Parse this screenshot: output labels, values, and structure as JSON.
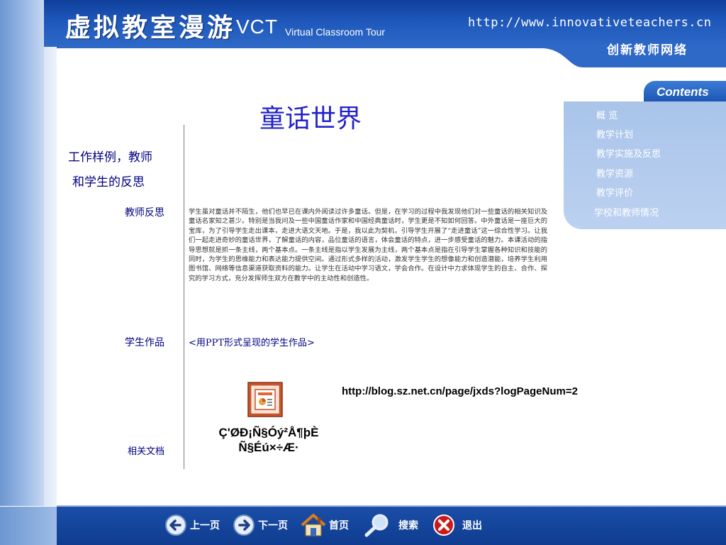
{
  "header": {
    "logo": "虚拟教室漫游",
    "vct": "VCT",
    "vct_subtitle": "Virtual Classroom Tour",
    "url": "http://www.innovativeteachers.cn",
    "org": "创新教师网络"
  },
  "contents": {
    "tab": "Contents",
    "items": [
      "概  览",
      "教学计划",
      "教学实施及反思",
      "教学资源",
      "教学评价",
      "学校和教师情况"
    ]
  },
  "main": {
    "title": "童话世界",
    "side_heading_1": "工作样例，教师",
    "side_heading_2": "和学生的反思",
    "teacher_label": "教师反思",
    "teacher_text": "学生虽对童话并不陌生，他们也早已在课内外阅读过许多童话。但是，在学习的过程中我发现他们对一些童话的相关知识及童话名家知之甚少。特别是当我问及一些中国童话作家和中国经典童话时，学生更是不知如何回答。中外童话是一座巨大的宝库，为了引导学生走出课本，走进大语文天地。于是，我以此为契机，引导学生开展了“走进童话”这一综合性学习。让我们一起走进奇妙的童话世界，了解童话的内容，品位童话的语言，体会童话的特点，进一步感受童话的魅力。本课活动的指导思想就是抓一条主线，两个基本点。一条主线是指以学生发展为主线，两个基本点是指在引导学生掌握各种知识和技能的同时，为学生的思维能力和表达能力提供空间。通过形式多样的活动，激发学生学生的想像能力和创造潜能，培养学生利用图书馆、网络等信息渠道获取资料的能力。让学生在活动中学习语文，学会合作。在设计中力求体现学生的自主、合作、探究的学习方式，充分发挥师生双方在教学中的主动性和创造性。",
    "student_label": "学生作品",
    "ppt_link": "<用PPT形式呈现的学生作品>",
    "ppt_caption": "Ç'ØÐ¡Ñ§Óý²Å¶þÈ Ñ§Éú×÷Æ·",
    "blog_link": "http://blog.sz.net.cn/page/jxds?logPageNum=2",
    "docs_label": "相关文档"
  },
  "footer": {
    "prev": "上一页",
    "next": "下一页",
    "home": "首页",
    "search": "搜索",
    "exit": "退出"
  },
  "colors": {
    "header_blue": "#1d56b8",
    "title_blue": "#2222cc",
    "label_navy": "#000080",
    "panel_blue": "#a9c4ea"
  }
}
